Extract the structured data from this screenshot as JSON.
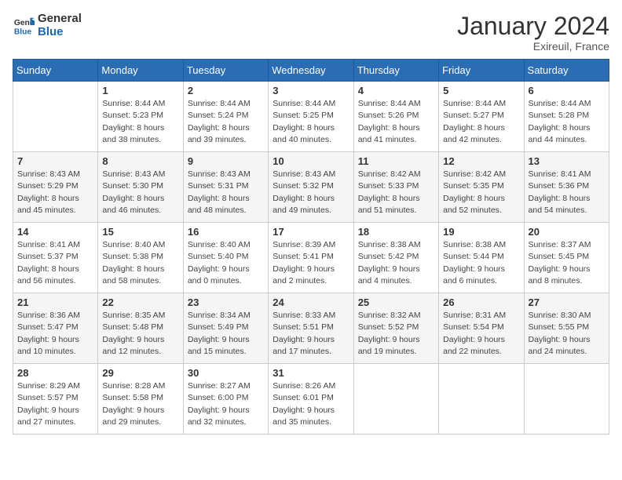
{
  "header": {
    "logo_line1": "General",
    "logo_line2": "Blue",
    "month": "January 2024",
    "location": "Exireuil, France"
  },
  "columns": [
    "Sunday",
    "Monday",
    "Tuesday",
    "Wednesday",
    "Thursday",
    "Friday",
    "Saturday"
  ],
  "weeks": [
    [
      {
        "day": "",
        "sunrise": "",
        "sunset": "",
        "daylight": ""
      },
      {
        "day": "1",
        "sunrise": "Sunrise: 8:44 AM",
        "sunset": "Sunset: 5:23 PM",
        "daylight": "Daylight: 8 hours and 38 minutes."
      },
      {
        "day": "2",
        "sunrise": "Sunrise: 8:44 AM",
        "sunset": "Sunset: 5:24 PM",
        "daylight": "Daylight: 8 hours and 39 minutes."
      },
      {
        "day": "3",
        "sunrise": "Sunrise: 8:44 AM",
        "sunset": "Sunset: 5:25 PM",
        "daylight": "Daylight: 8 hours and 40 minutes."
      },
      {
        "day": "4",
        "sunrise": "Sunrise: 8:44 AM",
        "sunset": "Sunset: 5:26 PM",
        "daylight": "Daylight: 8 hours and 41 minutes."
      },
      {
        "day": "5",
        "sunrise": "Sunrise: 8:44 AM",
        "sunset": "Sunset: 5:27 PM",
        "daylight": "Daylight: 8 hours and 42 minutes."
      },
      {
        "day": "6",
        "sunrise": "Sunrise: 8:44 AM",
        "sunset": "Sunset: 5:28 PM",
        "daylight": "Daylight: 8 hours and 44 minutes."
      }
    ],
    [
      {
        "day": "7",
        "sunrise": "Sunrise: 8:43 AM",
        "sunset": "Sunset: 5:29 PM",
        "daylight": "Daylight: 8 hours and 45 minutes."
      },
      {
        "day": "8",
        "sunrise": "Sunrise: 8:43 AM",
        "sunset": "Sunset: 5:30 PM",
        "daylight": "Daylight: 8 hours and 46 minutes."
      },
      {
        "day": "9",
        "sunrise": "Sunrise: 8:43 AM",
        "sunset": "Sunset: 5:31 PM",
        "daylight": "Daylight: 8 hours and 48 minutes."
      },
      {
        "day": "10",
        "sunrise": "Sunrise: 8:43 AM",
        "sunset": "Sunset: 5:32 PM",
        "daylight": "Daylight: 8 hours and 49 minutes."
      },
      {
        "day": "11",
        "sunrise": "Sunrise: 8:42 AM",
        "sunset": "Sunset: 5:33 PM",
        "daylight": "Daylight: 8 hours and 51 minutes."
      },
      {
        "day": "12",
        "sunrise": "Sunrise: 8:42 AM",
        "sunset": "Sunset: 5:35 PM",
        "daylight": "Daylight: 8 hours and 52 minutes."
      },
      {
        "day": "13",
        "sunrise": "Sunrise: 8:41 AM",
        "sunset": "Sunset: 5:36 PM",
        "daylight": "Daylight: 8 hours and 54 minutes."
      }
    ],
    [
      {
        "day": "14",
        "sunrise": "Sunrise: 8:41 AM",
        "sunset": "Sunset: 5:37 PM",
        "daylight": "Daylight: 8 hours and 56 minutes."
      },
      {
        "day": "15",
        "sunrise": "Sunrise: 8:40 AM",
        "sunset": "Sunset: 5:38 PM",
        "daylight": "Daylight: 8 hours and 58 minutes."
      },
      {
        "day": "16",
        "sunrise": "Sunrise: 8:40 AM",
        "sunset": "Sunset: 5:40 PM",
        "daylight": "Daylight: 9 hours and 0 minutes."
      },
      {
        "day": "17",
        "sunrise": "Sunrise: 8:39 AM",
        "sunset": "Sunset: 5:41 PM",
        "daylight": "Daylight: 9 hours and 2 minutes."
      },
      {
        "day": "18",
        "sunrise": "Sunrise: 8:38 AM",
        "sunset": "Sunset: 5:42 PM",
        "daylight": "Daylight: 9 hours and 4 minutes."
      },
      {
        "day": "19",
        "sunrise": "Sunrise: 8:38 AM",
        "sunset": "Sunset: 5:44 PM",
        "daylight": "Daylight: 9 hours and 6 minutes."
      },
      {
        "day": "20",
        "sunrise": "Sunrise: 8:37 AM",
        "sunset": "Sunset: 5:45 PM",
        "daylight": "Daylight: 9 hours and 8 minutes."
      }
    ],
    [
      {
        "day": "21",
        "sunrise": "Sunrise: 8:36 AM",
        "sunset": "Sunset: 5:47 PM",
        "daylight": "Daylight: 9 hours and 10 minutes."
      },
      {
        "day": "22",
        "sunrise": "Sunrise: 8:35 AM",
        "sunset": "Sunset: 5:48 PM",
        "daylight": "Daylight: 9 hours and 12 minutes."
      },
      {
        "day": "23",
        "sunrise": "Sunrise: 8:34 AM",
        "sunset": "Sunset: 5:49 PM",
        "daylight": "Daylight: 9 hours and 15 minutes."
      },
      {
        "day": "24",
        "sunrise": "Sunrise: 8:33 AM",
        "sunset": "Sunset: 5:51 PM",
        "daylight": "Daylight: 9 hours and 17 minutes."
      },
      {
        "day": "25",
        "sunrise": "Sunrise: 8:32 AM",
        "sunset": "Sunset: 5:52 PM",
        "daylight": "Daylight: 9 hours and 19 minutes."
      },
      {
        "day": "26",
        "sunrise": "Sunrise: 8:31 AM",
        "sunset": "Sunset: 5:54 PM",
        "daylight": "Daylight: 9 hours and 22 minutes."
      },
      {
        "day": "27",
        "sunrise": "Sunrise: 8:30 AM",
        "sunset": "Sunset: 5:55 PM",
        "daylight": "Daylight: 9 hours and 24 minutes."
      }
    ],
    [
      {
        "day": "28",
        "sunrise": "Sunrise: 8:29 AM",
        "sunset": "Sunset: 5:57 PM",
        "daylight": "Daylight: 9 hours and 27 minutes."
      },
      {
        "day": "29",
        "sunrise": "Sunrise: 8:28 AM",
        "sunset": "Sunset: 5:58 PM",
        "daylight": "Daylight: 9 hours and 29 minutes."
      },
      {
        "day": "30",
        "sunrise": "Sunrise: 8:27 AM",
        "sunset": "Sunset: 6:00 PM",
        "daylight": "Daylight: 9 hours and 32 minutes."
      },
      {
        "day": "31",
        "sunrise": "Sunrise: 8:26 AM",
        "sunset": "Sunset: 6:01 PM",
        "daylight": "Daylight: 9 hours and 35 minutes."
      },
      {
        "day": "",
        "sunrise": "",
        "sunset": "",
        "daylight": ""
      },
      {
        "day": "",
        "sunrise": "",
        "sunset": "",
        "daylight": ""
      },
      {
        "day": "",
        "sunrise": "",
        "sunset": "",
        "daylight": ""
      }
    ]
  ]
}
